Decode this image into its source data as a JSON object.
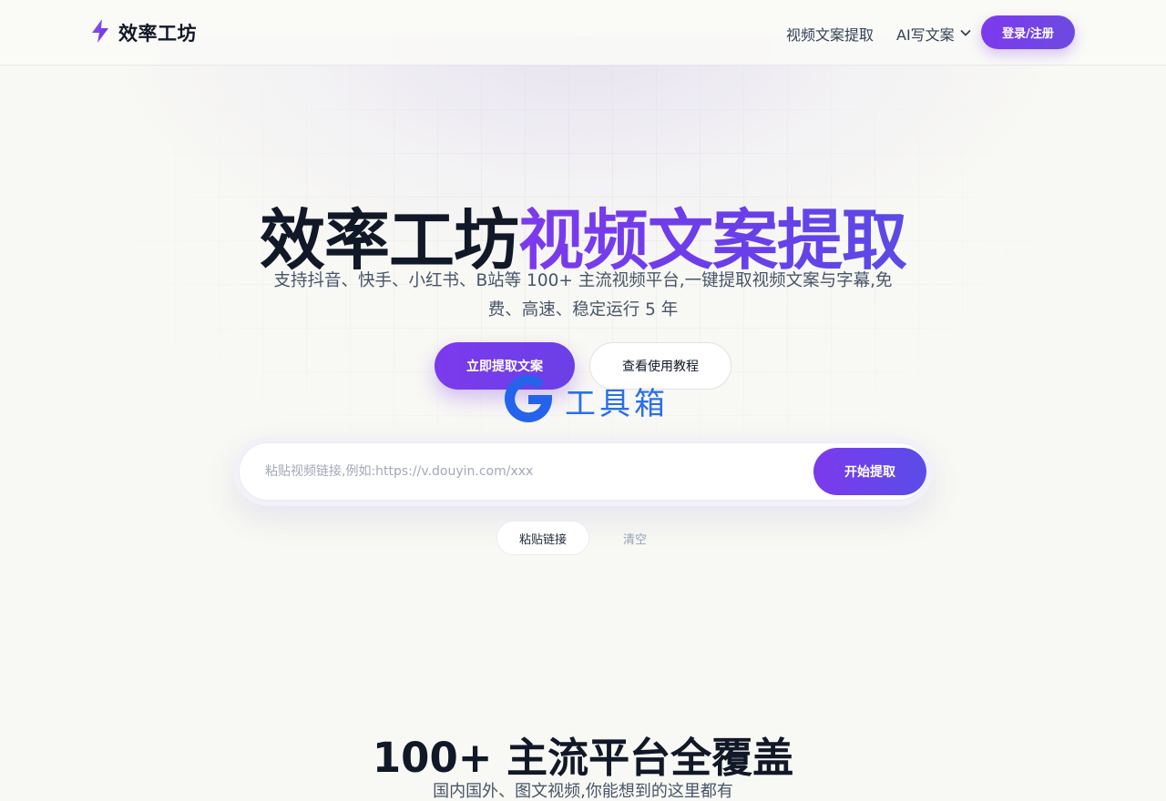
{
  "header": {
    "logo_text": "效率工坊",
    "logo_icon": "lightning-bolt-icon",
    "nav": {
      "extract_label": "视频文案提取",
      "ai_write_label": "AI写文案",
      "ai_write_icon": "chevron-down-icon"
    },
    "login_label": "登录/注册"
  },
  "hero": {
    "title_dark": "效率工坊",
    "title_accent": "视频文案提取",
    "subtitle": "支持抖音、快手、小红书、B站等 100+ 主流视频平台,一键提取视频文案与字幕,免费、高速、稳定运行 5 年",
    "primary_cta": "立即提取文案",
    "secondary_cta": "查看使用教程"
  },
  "watermark": {
    "text": "工具箱",
    "icon": "g-logo-icon"
  },
  "search": {
    "placeholder": "粘贴视频链接,例如:https://v.douyin.com/xxx",
    "value": "",
    "submit_label": "开始提取",
    "paste_label": "粘贴链接",
    "clear_label": "清空"
  },
  "platforms": {
    "title": "100+ 主流平台全覆盖",
    "subtitle": "国内国外、图文视频,你能想到的这里都有"
  },
  "colors": {
    "accent": "#7c3aed",
    "accent_end": "#5b4ae6",
    "text_dark": "#111827",
    "text_muted": "#475569",
    "background": "#f8f8f4",
    "watermark_blue": "#2a6fe8"
  }
}
